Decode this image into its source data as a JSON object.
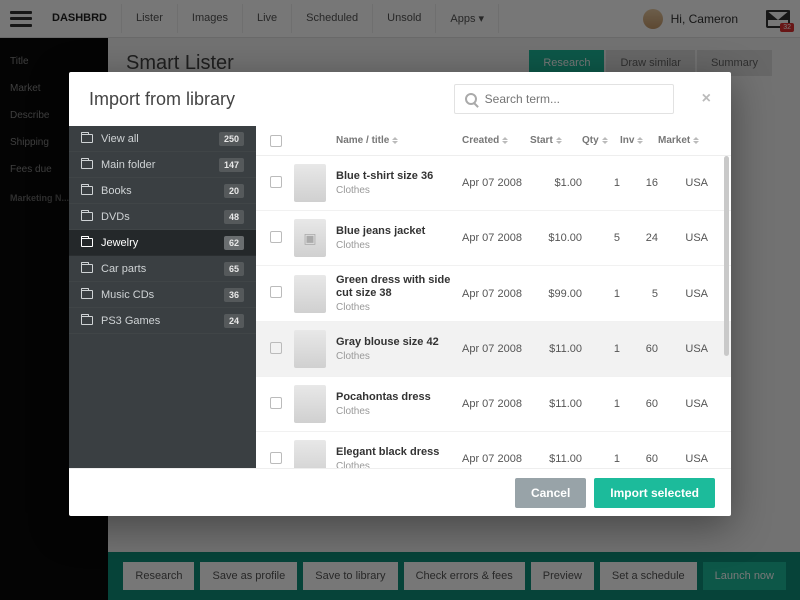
{
  "topnav": {
    "items": [
      "DASHBRD",
      "Lister",
      "Images",
      "Live",
      "Scheduled",
      "Unsold",
      "Apps ▾"
    ],
    "user_greeting": "Hi, Cameron",
    "mail_badge": "32"
  },
  "leftnav": {
    "items": [
      "Title",
      "Market",
      "Describe",
      "Shipping",
      "Fees due"
    ],
    "section": "Marketing N..."
  },
  "page": {
    "title": "Smart Lister",
    "tabs": [
      "Research",
      "Draw similar",
      "Summary"
    ]
  },
  "bottombar": {
    "buttons": [
      "Research",
      "Save as profile",
      "Save to library",
      "Check errors & fees",
      "Preview",
      "Set a schedule",
      "Launch now"
    ]
  },
  "modal": {
    "title": "Import from library",
    "search_placeholder": "Search term...",
    "folders": [
      {
        "label": "View all",
        "count": "250"
      },
      {
        "label": "Main folder",
        "count": "147"
      },
      {
        "label": "Books",
        "count": "20"
      },
      {
        "label": "DVDs",
        "count": "48"
      },
      {
        "label": "Jewelry",
        "count": "62",
        "selected": true
      },
      {
        "label": "Car parts",
        "count": "65"
      },
      {
        "label": "Music CDs",
        "count": "36"
      },
      {
        "label": "PS3 Games",
        "count": "24"
      }
    ],
    "columns": {
      "name": "Name / title",
      "created": "Created",
      "start": "Start",
      "qty": "Qty",
      "inv": "Inv",
      "market": "Market"
    },
    "rows": [
      {
        "title": "Blue t-shirt size 36",
        "cat": "Clothes",
        "created": "Apr 07 2008",
        "start": "$1.00",
        "qty": "1",
        "inv": "16",
        "market": "USA",
        "thumb": "th-blue"
      },
      {
        "title": "Blue jeans jacket",
        "cat": "Clothes",
        "created": "Apr 07 2008",
        "start": "$10.00",
        "qty": "5",
        "inv": "24",
        "market": "USA",
        "thumb": "th-img",
        "icon": true
      },
      {
        "title": "Green dress with side cut size 38",
        "cat": "Clothes",
        "created": "Apr 07 2008",
        "start": "$99.00",
        "qty": "1",
        "inv": "5",
        "market": "USA",
        "thumb": "th-green"
      },
      {
        "title": "Gray blouse size 42",
        "cat": "Clothes",
        "created": "Apr 07 2008",
        "start": "$11.00",
        "qty": "1",
        "inv": "60",
        "market": "USA",
        "thumb": "th-gray",
        "selected": true
      },
      {
        "title": "Pocahontas dress",
        "cat": "Clothes",
        "created": "Apr 07 2008",
        "start": "$11.00",
        "qty": "1",
        "inv": "60",
        "market": "USA",
        "thumb": "th-tan"
      },
      {
        "title": "Elegant black dress",
        "cat": "Clothes",
        "created": "Apr 07 2008",
        "start": "$11.00",
        "qty": "1",
        "inv": "60",
        "market": "USA",
        "thumb": "th-dark"
      }
    ],
    "footer": {
      "cancel": "Cancel",
      "import": "Import selected"
    }
  }
}
